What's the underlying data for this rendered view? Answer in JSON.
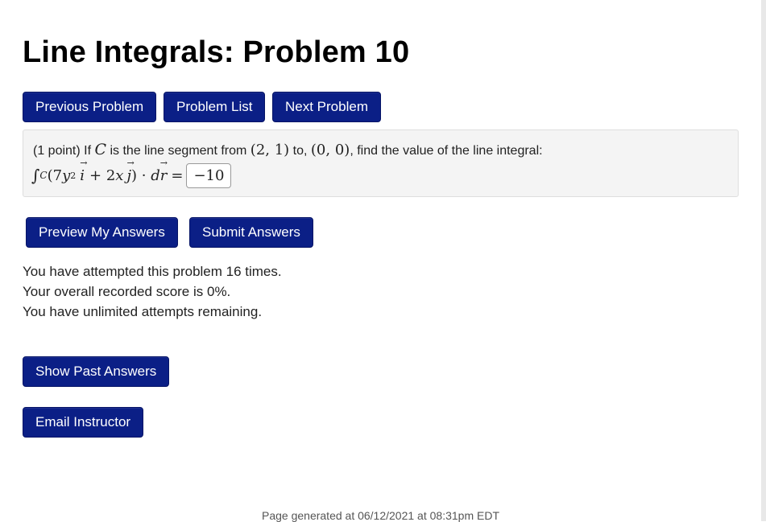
{
  "page": {
    "title": "Line Integrals: Problem 10"
  },
  "nav": {
    "previous_label": "Previous Problem",
    "list_label": "Problem List",
    "next_label": "Next Problem"
  },
  "problem": {
    "points_prefix": "(1 point) If",
    "curve_symbol": "C",
    "text_segment": "is the line segment from",
    "start_point": "(2, 1)",
    "to_text": "to,",
    "end_point": "(0, 0)",
    "text_find": ", find the value of the line integral:",
    "integral_sign": "∫",
    "integral_sub": "C",
    "open_paren": "(7",
    "y_var": "y",
    "exp": "2",
    "i_vec": "i",
    "plus_term": "+ 2",
    "x_var": "x",
    "j_vec": "j",
    "close_dot": ") · ",
    "d_letter": "d",
    "r_vec": "r",
    "equals": "=",
    "answer_value": "−10"
  },
  "actions": {
    "preview_label": "Preview My Answers",
    "submit_label": "Submit Answers"
  },
  "status": {
    "attempts": "You have attempted this problem 16 times.",
    "score": "Your overall recorded score is 0%.",
    "remaining": "You have unlimited attempts remaining."
  },
  "extra": {
    "past_answers_label": "Show Past Answers",
    "email_label": "Email Instructor"
  },
  "footer": {
    "text": "Page generated at 06/12/2021 at 08:31pm EDT"
  },
  "colors": {
    "button_bg": "#0b1f86",
    "problem_bg": "#f4f4f4"
  }
}
